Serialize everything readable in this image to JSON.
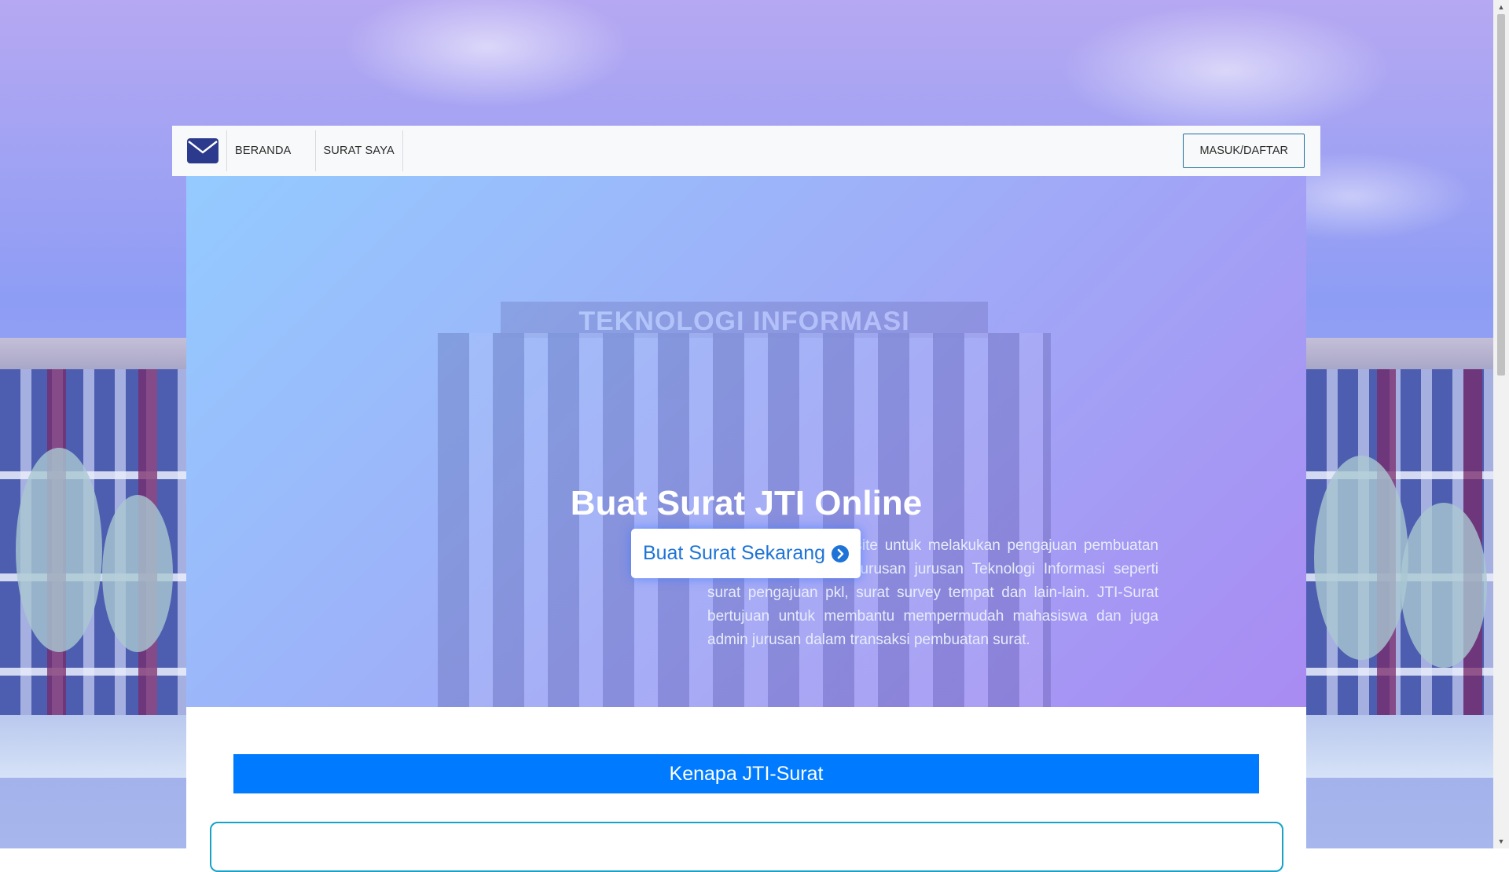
{
  "navbar": {
    "brand_icon": "envelope-icon",
    "links": [
      "BERANDA",
      "SURAT SAYA"
    ],
    "login_label": "MASUK/DAFTAR"
  },
  "hero": {
    "background_sign": "TEKNOLOGI INFORMASI",
    "title": "Buat Surat JTI Online",
    "description": "JTI-Surat adalah website untuk melakukan pengajuan pembuatan surat kepada Admin jurusan jurusan Teknologi Informasi seperti surat pengajuan pkl, surat survey tempat dan lain-lain. JTI-Surat bertujuan untuk membantu mempermudah mahasiswa dan juga admin jurusan dalam transaksi pembuatan surat.",
    "cta_label": "Buat Surat Sekarang",
    "cta_icon": "chevron-circle-right-icon"
  },
  "section": {
    "heading": "Kenapa JTI-Surat"
  },
  "colors": {
    "primary": "#007bff",
    "navbar_bg": "#f8f9fa",
    "card_border": "#17a2c8",
    "brand_icon": "#2b3a8c"
  }
}
